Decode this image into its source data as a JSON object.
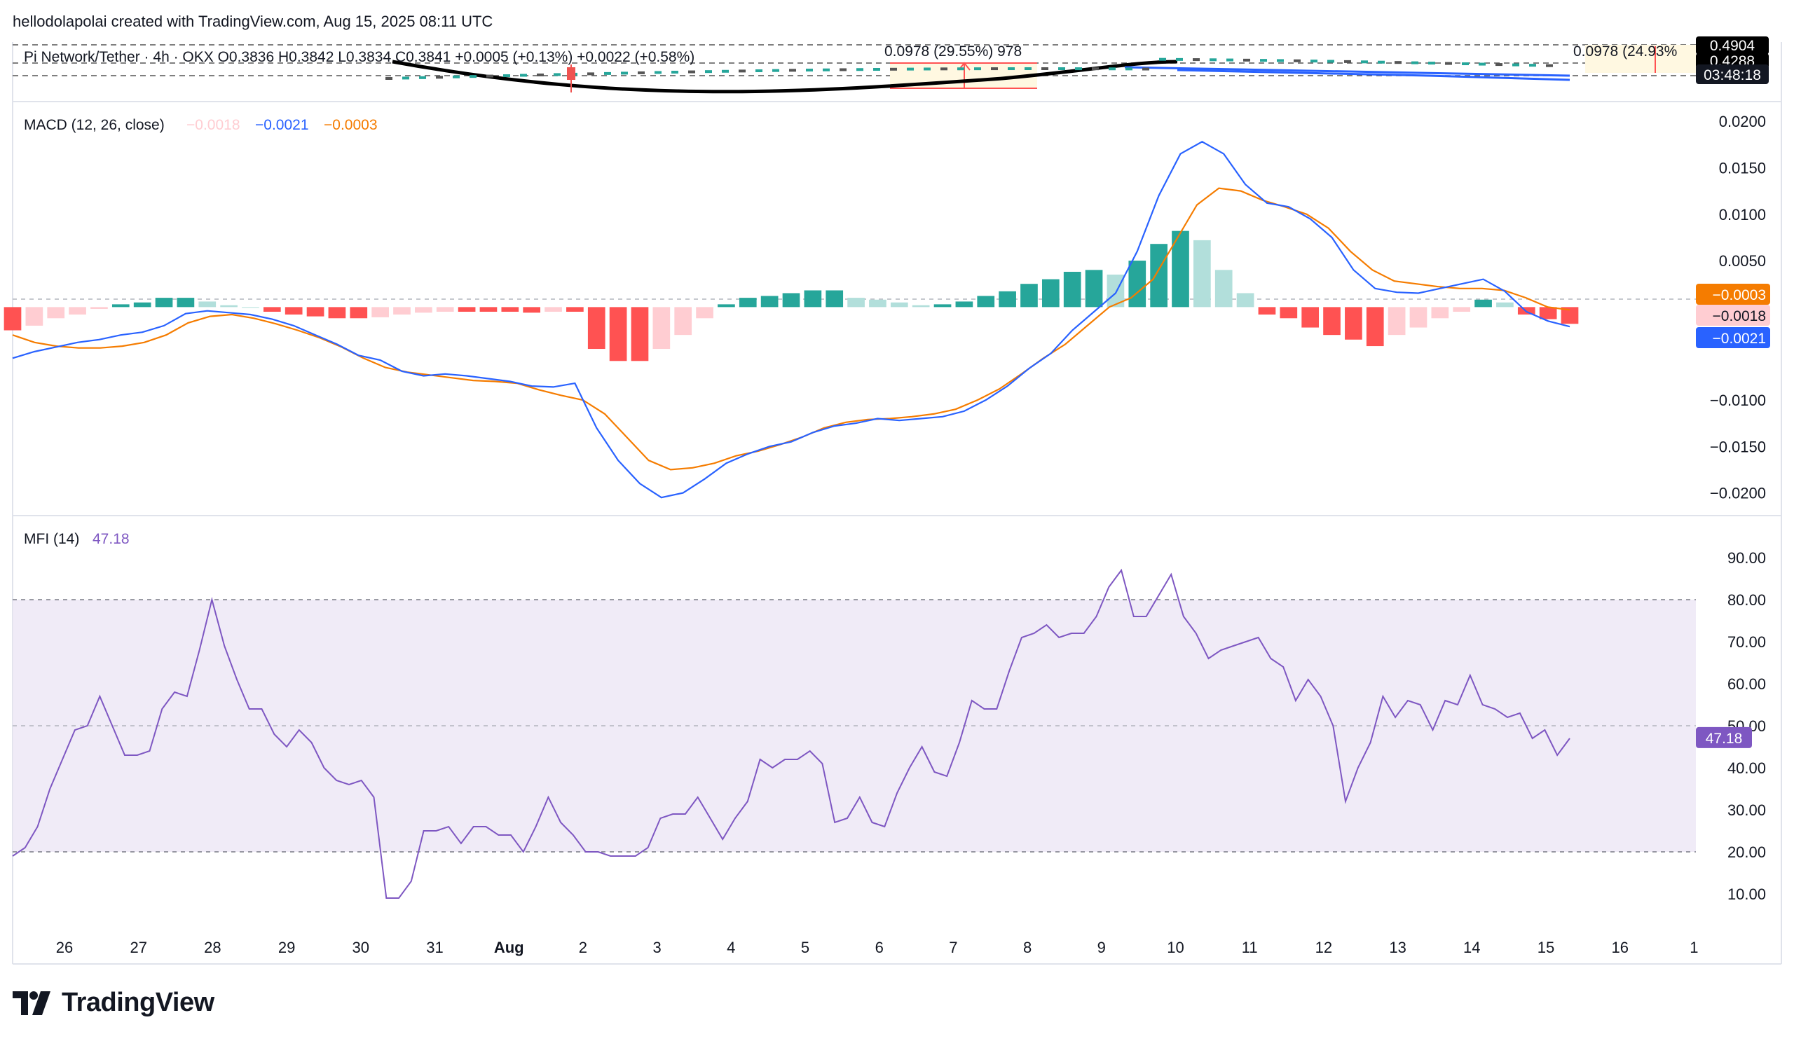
{
  "header": "hellodolapolai created with TradingView.com, Aug 15, 2025 08:11 UTC",
  "price_pane": {
    "legend": "Pi Network/Tether · 4h · OKX  O0.3836  H0.3842  L0.3834  C0.3841  +0.0005 (+0.13%)  +0.0022 (+0.58%)",
    "measure_label_1": "0.0978 (29.55%) 978",
    "measure_label_2": "0.0978 (24.93%",
    "price_tags": [
      "0.4904",
      "0.4288",
      "03:48:18"
    ]
  },
  "macd": {
    "title": "MACD (12, 26, close)",
    "hist_value": "−0.0018",
    "macd_value": "−0.0021",
    "signal_value": "−0.0003",
    "axis_ticks": [
      "0.0200",
      "0.0150",
      "0.0100",
      "0.0050",
      "−0.0100",
      "−0.0150",
      "−0.0200"
    ],
    "tags": [
      {
        "text": "−0.0003",
        "bg": "#f57c00",
        "fg": "#ffffff"
      },
      {
        "text": "−0.0018",
        "bg": "#ffcdd2",
        "fg": "#131722"
      },
      {
        "text": "−0.0021",
        "bg": "#2962ff",
        "fg": "#ffffff"
      }
    ]
  },
  "mfi": {
    "title": "MFI (14)",
    "value": "47.18",
    "axis_ticks": [
      "90.00",
      "80.00",
      "70.00",
      "60.00",
      "50.00",
      "40.00",
      "30.00",
      "20.00",
      "10.00"
    ],
    "tag": "47.18"
  },
  "time_axis": [
    "26",
    "27",
    "28",
    "29",
    "30",
    "31",
    "Aug",
    "2",
    "3",
    "4",
    "5",
    "6",
    "7",
    "8",
    "9",
    "10",
    "11",
    "12",
    "13",
    "14",
    "15",
    "16",
    "1"
  ],
  "brand": "TradingView",
  "colors": {
    "macd_line": "#2962ff",
    "signal_line": "#f57c00",
    "hist_pos_strong": "#26a69a",
    "hist_pos_weak": "#b2dfdb",
    "hist_neg_strong": "#ff5252",
    "hist_neg_weak": "#ffcdd2",
    "mfi_line": "#7e57c2",
    "mfi_band": "#ede7f6"
  },
  "chart_data": [
    {
      "type": "line",
      "name": "MACD (12, 26, close)",
      "x_labels": [
        "26",
        "27",
        "28",
        "29",
        "30",
        "31",
        "Aug",
        "2",
        "3",
        "4",
        "5",
        "6",
        "7",
        "8",
        "9",
        "10",
        "11",
        "12",
        "13",
        "14",
        "15"
      ],
      "series": [
        {
          "name": "MACD",
          "values": [
            -0.0055,
            -0.0048,
            -0.0043,
            -0.0038,
            -0.0035,
            -0.003,
            -0.0027,
            -0.002,
            -0.0007,
            -0.0004,
            -0.0006,
            -0.0008,
            -0.0013,
            -0.002,
            -0.003,
            -0.004,
            -0.0052,
            -0.0057,
            -0.0069,
            -0.0074,
            -0.0072,
            -0.0074,
            -0.0077,
            -0.008,
            -0.0085,
            -0.0086,
            -0.0082,
            -0.013,
            -0.0165,
            -0.019,
            -0.0205,
            -0.02,
            -0.0185,
            -0.0168,
            -0.0158,
            -0.015,
            -0.0145,
            -0.0135,
            -0.0128,
            -0.0125,
            -0.012,
            -0.0122,
            -0.012,
            -0.0118,
            -0.0112,
            -0.01,
            -0.0085,
            -0.0066,
            -0.005,
            -0.0025,
            -0.0005,
            0.0015,
            0.006,
            0.012,
            0.0165,
            0.0178,
            0.0165,
            0.0132,
            0.0112,
            0.0108,
            0.0095,
            0.0075,
            0.004,
            0.002,
            0.0016,
            0.0015,
            0.002,
            0.0025,
            0.003,
            0.0017,
            -0.0005,
            -0.0015,
            -0.0021
          ]
        },
        {
          "name": "Signal",
          "values": [
            -0.003,
            -0.0038,
            -0.0042,
            -0.0044,
            -0.0044,
            -0.0042,
            -0.0038,
            -0.003,
            -0.0017,
            -0.001,
            -0.0008,
            -0.0012,
            -0.0018,
            -0.0025,
            -0.0033,
            -0.0043,
            -0.0055,
            -0.0065,
            -0.007,
            -0.0073,
            -0.0076,
            -0.0079,
            -0.008,
            -0.0082,
            -0.0089,
            -0.0095,
            -0.01,
            -0.0115,
            -0.014,
            -0.0165,
            -0.0175,
            -0.0173,
            -0.0168,
            -0.016,
            -0.0155,
            -0.0148,
            -0.014,
            -0.013,
            -0.0124,
            -0.0121,
            -0.012,
            -0.0118,
            -0.0115,
            -0.011,
            -0.01,
            -0.0088,
            -0.0072,
            -0.0055,
            -0.004,
            -0.002,
            0.0,
            0.001,
            0.003,
            0.007,
            0.011,
            0.0128,
            0.0125,
            0.0115,
            0.0108,
            0.01,
            0.0085,
            0.006,
            0.004,
            0.0028,
            0.0025,
            0.0022,
            0.002,
            0.002,
            0.0018,
            0.001,
            0.0,
            -0.0003
          ]
        }
      ],
      "histogram": [
        -0.0025,
        -0.002,
        -0.0012,
        -0.0008,
        -0.0002,
        0.0003,
        0.0005,
        0.001,
        0.001,
        0.0006,
        0.0002,
        0.0,
        -0.0005,
        -0.0008,
        -0.001,
        -0.0012,
        -0.0012,
        -0.0011,
        -0.0008,
        -0.0006,
        -0.0005,
        -0.0005,
        -0.0005,
        -0.0005,
        -0.0006,
        -0.0005,
        -0.0005,
        -0.0045,
        -0.0058,
        -0.0058,
        -0.0045,
        -0.003,
        -0.0012,
        0.0003,
        0.001,
        0.0012,
        0.0015,
        0.0018,
        0.0018,
        0.001,
        0.0008,
        0.0005,
        0.0002,
        0.0003,
        0.0006,
        0.0012,
        0.0017,
        0.0025,
        0.003,
        0.0038,
        0.004,
        0.0035,
        0.005,
        0.0068,
        0.0082,
        0.0072,
        0.004,
        0.0015,
        -0.0008,
        -0.0012,
        -0.0022,
        -0.003,
        -0.0035,
        -0.0042,
        -0.003,
        -0.0022,
        -0.0012,
        -0.0005,
        0.0008,
        0.0005,
        -0.0008,
        -0.0013,
        -0.0018
      ],
      "ylim": [
        -0.0235,
        0.0225
      ]
    },
    {
      "type": "line",
      "name": "MFI (14)",
      "x_labels": [
        "26",
        "27",
        "28",
        "29",
        "30",
        "31",
        "Aug",
        "2",
        "3",
        "4",
        "5",
        "6",
        "7",
        "8",
        "9",
        "10",
        "11",
        "12",
        "13",
        "14",
        "15"
      ],
      "series": [
        {
          "name": "MFI",
          "values": [
            19,
            21,
            26,
            35,
            42,
            49,
            50,
            57,
            50,
            43,
            43,
            44,
            54,
            58,
            57,
            68,
            80,
            69,
            61,
            54,
            54,
            48,
            45,
            49,
            46,
            40,
            37,
            36,
            37,
            33,
            9,
            9,
            13,
            25,
            25,
            26,
            22,
            26,
            26,
            24,
            24,
            20,
            26,
            33,
            27,
            24,
            20,
            20,
            19,
            19,
            19,
            21,
            28,
            29,
            29,
            33,
            28,
            23,
            28,
            32,
            42,
            40,
            42,
            42,
            44,
            41,
            27,
            28,
            33,
            27,
            26,
            34,
            40,
            45,
            39,
            38,
            46,
            56,
            54,
            54,
            63,
            71,
            72,
            74,
            71,
            72,
            72,
            76,
            83,
            87,
            76,
            76,
            81,
            86,
            76,
            72,
            66,
            68,
            69,
            70,
            71,
            66,
            64,
            56,
            61,
            57,
            50,
            32,
            40,
            46,
            57,
            52,
            56,
            55,
            49,
            56,
            55,
            62,
            55,
            54,
            52,
            53,
            47,
            49,
            43,
            47
          ]
        }
      ],
      "bands": [
        20,
        50,
        80
      ],
      "ylim": [
        1,
        96
      ]
    }
  ]
}
